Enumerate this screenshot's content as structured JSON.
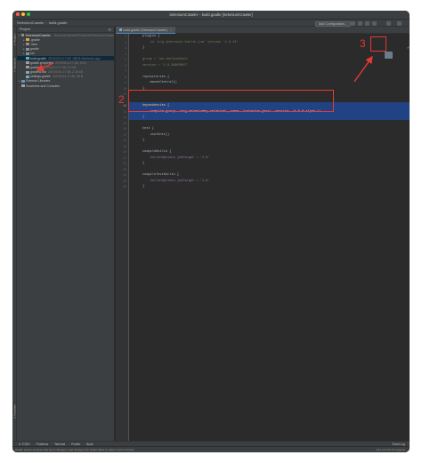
{
  "window": {
    "title": "SeleniumCrawler – build.gradle [SeleniumCrawler]"
  },
  "navbar": {
    "breadcrumb_project": "SeleniumCrawler",
    "breadcrumb_file": "build.gradle",
    "run_config": "Add Configuration..."
  },
  "project_panel": {
    "header": "Project",
    "tree": [
      {
        "label": "SeleniumCrawler",
        "detail": "~/Documents/WebProjects/SeleniumCrawler",
        "icon": "folder-icon"
      },
      {
        "label": ".gradle",
        "detail": "",
        "icon": "folder-icon"
      },
      {
        "label": ".idea",
        "detail": "",
        "icon": "folder-icon"
      },
      {
        "label": "gradle",
        "detail": "",
        "icon": "folder-icon"
      },
      {
        "label": "src",
        "detail": "",
        "icon": "folder-icon"
      },
      {
        "label": "build.gradle",
        "detail": "2019/3/14 17:48, 188 B Moments ago",
        "icon": "gradle-icon"
      },
      {
        "label": "gradle.properties",
        "detail": "2019/3/14 17:48, 26 B",
        "icon": "file-icon"
      },
      {
        "label": "gradlew",
        "detail": "2019/3/14 17:48, 5.4 kB",
        "icon": "file-icon"
      },
      {
        "label": "gradlew.bat",
        "detail": "2019/3/14 17:48, 2.18 kB",
        "icon": "file-icon"
      },
      {
        "label": "settings.gradle",
        "detail": "2019/3/14 17:48, 38 B",
        "icon": "gradle-icon"
      },
      {
        "label": "External Libraries",
        "detail": "",
        "icon": "library-icon"
      },
      {
        "label": "Scratches and Consoles",
        "detail": "",
        "icon": "scratch-icon"
      }
    ]
  },
  "editor": {
    "tab": "build.gradle (SeleniumCrawler)",
    "lines": [
      {
        "n": "1",
        "text": "plugins {"
      },
      {
        "n": "2",
        "text": "    id 'org.jetbrains.kotlin.jvm' version '1.3.21'"
      },
      {
        "n": "3",
        "text": "}"
      },
      {
        "n": "4",
        "text": ""
      },
      {
        "n": "5",
        "text": "group = 'me.sheltonchen'"
      },
      {
        "n": "6",
        "text": "version = '1.0-SNAPSHOT'"
      },
      {
        "n": "7",
        "text": ""
      },
      {
        "n": "8",
        "text": "repositories {"
      },
      {
        "n": "9",
        "text": "    mavenCentral()"
      },
      {
        "n": "10",
        "text": "}"
      },
      {
        "n": "11",
        "text": ""
      },
      {
        "n": "12",
        "text": "dependencies {"
      },
      {
        "n": "13",
        "text": "    compile group: 'org.seleniumhq.selenium', name: 'selenium-java', version: '4.0.0-alpha-1'"
      },
      {
        "n": "14",
        "text": "}"
      },
      {
        "n": "15",
        "text": ""
      },
      {
        "n": "16",
        "text": "test {"
      },
      {
        "n": "17",
        "text": "    useJUnit()"
      },
      {
        "n": "18",
        "text": "}"
      },
      {
        "n": "19",
        "text": ""
      },
      {
        "n": "20",
        "text": "compileKotlin {"
      },
      {
        "n": "21",
        "text": "    kotlinOptions.jvmTarget = '1.8'"
      },
      {
        "n": "22",
        "text": "}"
      },
      {
        "n": "23",
        "text": ""
      },
      {
        "n": "24",
        "text": "compileTestKotlin {"
      },
      {
        "n": "25",
        "text": "    kotlinOptions.jvmTarget = '1.8'"
      },
      {
        "n": "26",
        "text": "}"
      }
    ]
  },
  "left_tools": {
    "project": "1: Project",
    "structure": "7: Structure",
    "favorites": "2: Favorites"
  },
  "bottom_tools": {
    "todo": "6: TODO",
    "problems": "Problems",
    "terminal": "Terminal",
    "profiler": "Profiler",
    "build": "Build",
    "event_log": "Event Log"
  },
  "status": {
    "message": "Gradle project structure has been changed. Load changes into IntelliJ IDEA to make it work correctly.",
    "right": "13:1 LF UTF-8 4 spaces"
  },
  "annotations": {
    "n2": "2",
    "n3": "3"
  },
  "colors": {
    "annotation": "#e53935",
    "selection": "#214283",
    "background": "#2b2b2b"
  }
}
